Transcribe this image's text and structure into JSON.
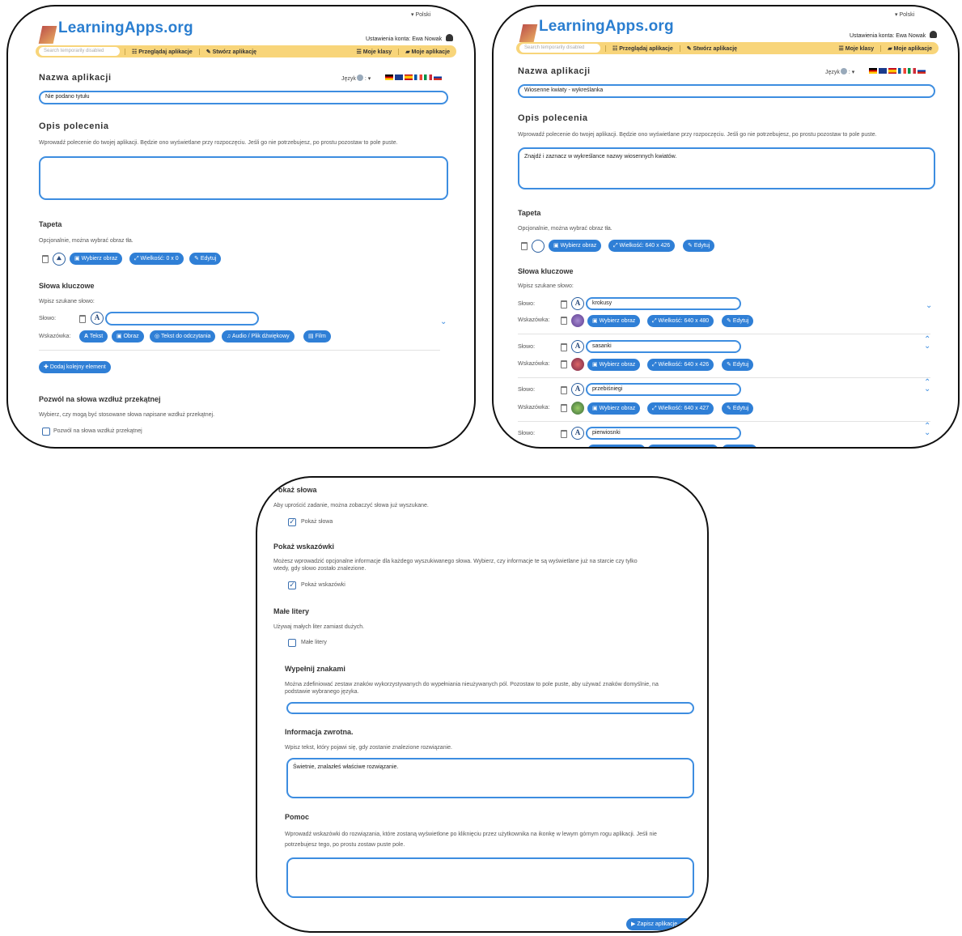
{
  "app": {
    "logo": "LearningApps.org",
    "language": "Polski",
    "account": "Ustawienia konta: Ewa Nowak",
    "search_placeholder": "Search temporarily disabled",
    "nav": {
      "browse": "Przeglądaj aplikacje",
      "create": "Stwórz aplikację",
      "classes": "Moje klasy",
      "myapps": "Moje aplikacje"
    }
  },
  "form": {
    "name_heading": "Nazwa aplikacji",
    "language_label": "Język",
    "task_heading": "Opis polecenia",
    "task_hint": "Wprowadź polecenie do twojej aplikacji. Będzie ono wyświetlane przy rozpoczęciu. Jeśli go nie potrzebujesz, po prostu pozostaw to pole puste.",
    "bg_heading": "Tapeta",
    "bg_hint": "Opcjonalnie, można wybrać obraz tła.",
    "choose_image": "Wybierz obraz",
    "edit": "Edytuj",
    "kw_heading": "Słowa kluczowe",
    "kw_hint": "Wpisz szukane słowo:",
    "word_label": "Słowo:",
    "hint_label": "Wskazówka:",
    "hint_text": "Tekst",
    "hint_image": "Obraz",
    "hint_tts": "Tekst do odczytania",
    "hint_audio": "Audio / Plik dźwiękowy",
    "hint_film": "Film",
    "add_element": "Dodaj kolejny element",
    "diag_heading": "Pozwól na słowa wzdłuż przekątnej",
    "diag_hint": "Wybierz, czy mogą być stosowane słowa napisane wzdłuż przekątnej.",
    "diag_check": "Pozwól na słowa wzdłuż przekątnej",
    "char_a": "A"
  },
  "panel1": {
    "title_value": "Nie podano tytułu",
    "size_label": "Wielkość: 0 x 0"
  },
  "panel2": {
    "title_value": "Wiosenne kwiaty - wykreślanka",
    "task_value": "Znajdź i zaznacz w wykreślance nazwy wiosennych kwiatów.",
    "size_label": "Wielkość: 640 x 426",
    "words": [
      {
        "word": "krokusy",
        "size": "Wielkość: 640 x 480"
      },
      {
        "word": "sasanki",
        "size": "Wielkość: 640 x 426"
      },
      {
        "word": "przebiśniegi",
        "size": "Wielkość: 640 x 427"
      },
      {
        "word": "pierwiosnki",
        "size": ""
      }
    ]
  },
  "panel3": {
    "show_words_heading": "Pokaż słowa",
    "show_words_hint": "Aby uprościć zadanie, można zobaczyć słowa już wyszukane.",
    "show_words_check": "Pokaż słowa",
    "show_hints_heading": "Pokaż wskazówki",
    "show_hints_hint1": "Możesz wprowadzić opcjonalne informacje dla każdego wyszukiwanego słowa. Wybierz, czy informacje te są wyświetlane już na starcie czy tylko",
    "show_hints_hint2": "wtedy, gdy słowo zostało znalezione.",
    "show_hints_check": "Pokaż wskazówki",
    "lower_heading": "Małe litery",
    "lower_hint": "Używaj małych liter zamiast dużych.",
    "lower_check": "Małe litery",
    "fill_heading": "Wypełnij znakami",
    "fill_hint1": "Można zdefiniować zestaw znaków wykorzystywanych do wypełniania nieużywanych pól. Pozostaw to pole puste, aby używać znaków domyślnie, na",
    "fill_hint2": "podstawie wybranego języka.",
    "feedback_heading": "Informacja zwrotna.",
    "feedback_hint": "Wpisz tekst, który pojawi się, gdy zostanie znalezione rozwiązanie.",
    "feedback_value": "Świetnie, znalazłeś właściwe rozwiązanie.",
    "help_heading": "Pomoc",
    "help_hint1": "Wprowadź wskazówki do rozwiązania, które zostaną wyświetlone po kliknięciu przez użytkownika na ikonkę w lewym górnym rogu aplikacji. Jeśli nie",
    "help_hint2": "potrzebujesz tego, po prostu zostaw puste pole.",
    "save_button": "Zapisz aplikację"
  },
  "colors": {
    "accent": "#2f7fd6",
    "navbar": "#f8d57a",
    "border": "#3d8de0"
  }
}
